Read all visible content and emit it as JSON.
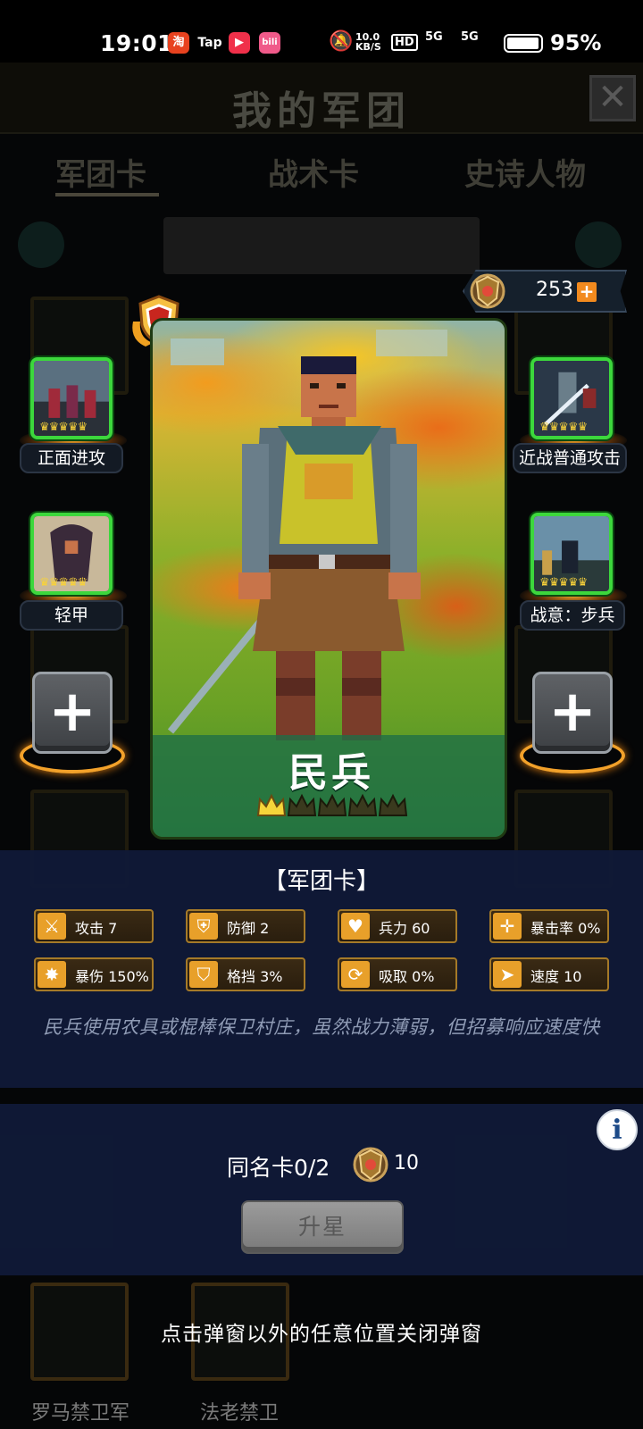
{
  "status_bar": {
    "time": "19:01",
    "apps": [
      "淘",
      "Tap",
      "▶",
      "bili"
    ],
    "net_speed": "10.0 KB/S",
    "hd": "HD",
    "signal1": "5G",
    "signal2": "5G",
    "battery": "95%"
  },
  "background": {
    "title": "我的军团",
    "tabs": [
      "军团卡",
      "战术卡",
      "史诗人物"
    ],
    "bottom_labels": [
      "罗马禁卫军",
      "法老禁卫"
    ]
  },
  "currency": {
    "value": "253",
    "plus": "+"
  },
  "card": {
    "name": "民兵",
    "stars_filled": 1,
    "stars_total": 5
  },
  "skills": {
    "left_top": "正面进攻",
    "left_mid": "轻甲",
    "right_top": "近战普通攻击",
    "right_mid": "战意：步兵",
    "add": "+"
  },
  "info": {
    "title": "【军团卡】",
    "stats": [
      {
        "icon": "sword-icon",
        "glyph": "⚔",
        "text": "攻击 7"
      },
      {
        "icon": "shield-icon",
        "glyph": "⛨",
        "text": "防御 2"
      },
      {
        "icon": "heart-icon",
        "glyph": "♥",
        "text": "兵力 60"
      },
      {
        "icon": "crosshair-icon",
        "glyph": "✛",
        "text": "暴击率 0%"
      },
      {
        "icon": "burst-icon",
        "glyph": "✸",
        "text": "暴伤 150%"
      },
      {
        "icon": "parry-icon",
        "glyph": "⛉",
        "text": "格挡 3%"
      },
      {
        "icon": "drain-icon",
        "glyph": "⟳",
        "text": "吸取 0%"
      },
      {
        "icon": "boot-icon",
        "glyph": "➤",
        "text": "速度 10"
      }
    ],
    "description": "民兵使用农具或棍棒保卫村庄，虽然战力薄弱，但招募响应速度快"
  },
  "upgrade": {
    "same_card": "同名卡0/2",
    "cost": "10",
    "button": "升星",
    "info_glyph": "i"
  },
  "dismiss_hint": "点击弹窗以外的任意位置关闭弹窗",
  "colors": {
    "panel": "#101a38",
    "accent_gold": "#e8a02a",
    "slot_green": "#3cd73c"
  }
}
